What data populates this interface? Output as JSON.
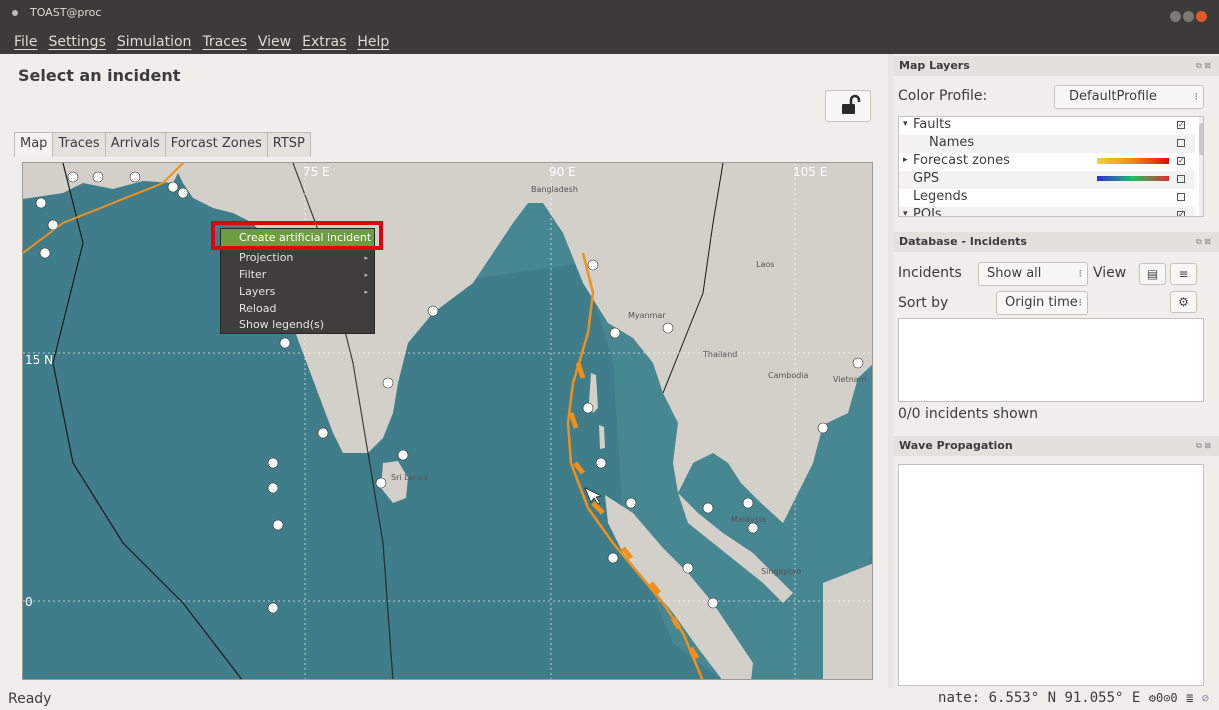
{
  "window": {
    "title": "TOAST@proc"
  },
  "menu": [
    "File",
    "Settings",
    "Simulation",
    "Traces",
    "View",
    "Extras",
    "Help"
  ],
  "main": {
    "title": "Select an incident",
    "tabs": [
      "Map",
      "Traces",
      "Arrivals",
      "Forcast Zones",
      "RTSP"
    ],
    "active_tab": "Map"
  },
  "map": {
    "lon_labels": [
      "75 E",
      "90 E",
      "105 E"
    ],
    "lat_labels": [
      "15 N",
      "0"
    ],
    "place_labels": [
      "Bangladesh",
      "Myanmar",
      "Thailand",
      "Laos",
      "Cambodia",
      "Vietnam",
      "Sri Lanka",
      "Malaysia",
      "Singapore"
    ],
    "colors": {
      "ocean": "#3f7d8b",
      "land": "#d2d0c9",
      "fault": "#f0901a"
    }
  },
  "context_menu": {
    "items": [
      {
        "label": "Create artificial incident",
        "highlighted": true
      },
      {
        "label": "Projection",
        "submenu": true
      },
      {
        "label": "Filter",
        "submenu": true
      },
      {
        "label": "Layers",
        "submenu": true
      },
      {
        "label": "Reload"
      },
      {
        "label": "Show legend(s)"
      }
    ]
  },
  "map_layers": {
    "header": "Map Layers",
    "color_profile_label": "Color Profile:",
    "color_profile_value": "DefaultProfile",
    "rows": [
      {
        "label": "Faults",
        "expander": "▾",
        "checked": true
      },
      {
        "label": "Names",
        "checked": false,
        "child": true
      },
      {
        "label": "Forecast zones",
        "expander": "▸",
        "checked": true
      },
      {
        "label": "GPS",
        "checked": false
      },
      {
        "label": "Legends",
        "checked": false
      },
      {
        "label": "POIs",
        "expander": "▾",
        "checked": true
      }
    ]
  },
  "incidents": {
    "header": "Database - Incidents",
    "incidents_label": "Incidents",
    "filter_value": "Show all",
    "view_label": "View",
    "sort_label": "Sort by",
    "sort_value": "Origin time",
    "count_text": "0/0 incidents shown"
  },
  "wave": {
    "header": "Wave Propagation"
  },
  "status": {
    "left": "Ready",
    "coord_text": "nate:  6.553° N  91.055° E"
  }
}
